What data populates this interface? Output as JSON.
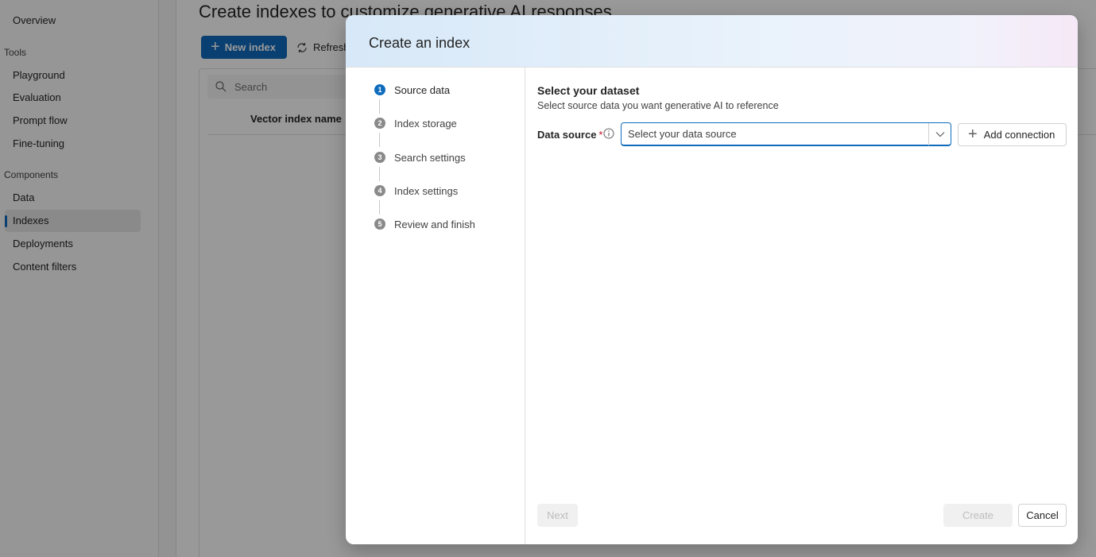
{
  "sidebar": {
    "overview": "Overview",
    "tools_heading": "Tools",
    "tools": [
      "Playground",
      "Evaluation",
      "Prompt flow",
      "Fine-tuning"
    ],
    "components_heading": "Components",
    "components": [
      "Data",
      "Indexes",
      "Deployments",
      "Content filters"
    ],
    "active_item": "Indexes"
  },
  "main": {
    "title": "Create indexes to customize generative AI responses",
    "new_index_label": "New index",
    "refresh_label": "Refresh",
    "search_placeholder": "Search",
    "column_vector_index_name": "Vector index name"
  },
  "dialog": {
    "title": "Create an index",
    "steps": [
      {
        "num": "1",
        "label": "Source data",
        "active": true
      },
      {
        "num": "2",
        "label": "Index storage",
        "active": false
      },
      {
        "num": "3",
        "label": "Search settings",
        "active": false
      },
      {
        "num": "4",
        "label": "Index settings",
        "active": false
      },
      {
        "num": "5",
        "label": "Review and finish",
        "active": false
      }
    ],
    "section_title": "Select your dataset",
    "section_subtitle": "Select source data you want generative AI to reference",
    "data_source_label": "Data source",
    "required_marker": "*",
    "data_source_placeholder": "Select your data source",
    "add_connection_label": "Add connection",
    "next_label": "Next",
    "create_label": "Create",
    "cancel_label": "Cancel"
  },
  "colors": {
    "accent": "#0f6cbd",
    "required": "#c50f1f",
    "overlay": "rgba(0,0,0,0.4)"
  }
}
